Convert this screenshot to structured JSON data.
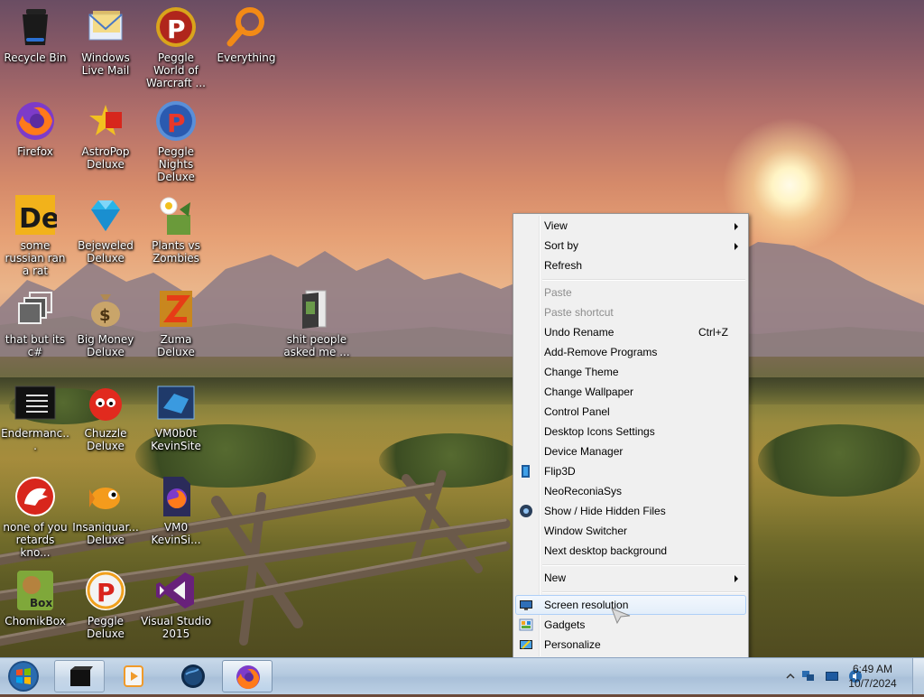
{
  "desktop": {
    "icons": [
      {
        "label": "Recycle Bin",
        "icon": "recycle-bin-icon"
      },
      {
        "label": "Windows Live Mail",
        "icon": "mail-icon"
      },
      {
        "label": "Peggle World of Warcraft ...",
        "icon": "peggle-icon"
      },
      {
        "label": "Everything",
        "icon": "magnifier-icon"
      },
      {
        "label": "Firefox",
        "icon": "firefox-icon"
      },
      {
        "label": "AstroPop Deluxe",
        "icon": "astropop-icon"
      },
      {
        "label": "Peggle Nights Deluxe",
        "icon": "peggle-icon"
      },
      {
        "label": "some russian ran a rat",
        "icon": "de-icon"
      },
      {
        "label": "Bejeweled Deluxe",
        "icon": "gem-icon"
      },
      {
        "label": "Plants vs Zombies",
        "icon": "plant-icon"
      },
      {
        "label": "that but its c#",
        "icon": "windows-stack-icon"
      },
      {
        "label": "Big Money Deluxe",
        "icon": "money-bag-icon"
      },
      {
        "label": "Zuma Deluxe",
        "icon": "zuma-icon"
      },
      {
        "label": "shit people asked me ...",
        "icon": "folder-icon"
      },
      {
        "label": "Endermanc...",
        "icon": "terminal-icon"
      },
      {
        "label": "Chuzzle Deluxe",
        "icon": "chuzzle-icon"
      },
      {
        "label": "VM0b0t KevinSite",
        "icon": "vm-icon"
      },
      {
        "label": "none of you retards kno...",
        "icon": "dino-icon"
      },
      {
        "label": "Insaniquar... Deluxe",
        "icon": "fish-icon"
      },
      {
        "label": "VM0 KevinSi...",
        "icon": "firefox-file-icon"
      },
      {
        "label": "ChomikBox",
        "icon": "chomikbox-icon"
      },
      {
        "label": "Peggle Deluxe",
        "icon": "peggle-icon"
      },
      {
        "label": "Visual Studio 2015",
        "icon": "visual-studio-icon"
      }
    ]
  },
  "context_menu": {
    "items": [
      {
        "label": "View",
        "submenu": true
      },
      {
        "label": "Sort by",
        "submenu": true
      },
      {
        "label": "Refresh"
      },
      {
        "label": "Paste",
        "disabled": true
      },
      {
        "label": "Paste shortcut",
        "disabled": true
      },
      {
        "label": "Undo Rename",
        "shortcut": "Ctrl+Z"
      },
      {
        "label": "Add-Remove Programs"
      },
      {
        "label": "Change Theme"
      },
      {
        "label": "Change Wallpaper"
      },
      {
        "label": "Control Panel"
      },
      {
        "label": "Desktop Icons Settings"
      },
      {
        "label": "Device Manager"
      },
      {
        "label": "Flip3D",
        "icon": "flip3d-icon"
      },
      {
        "label": "NeoReconiaSys"
      },
      {
        "label": "Show / Hide Hidden Files",
        "icon": "eye-icon"
      },
      {
        "label": "Window Switcher"
      },
      {
        "label": "Next desktop background"
      },
      {
        "label": "New",
        "submenu": true
      },
      {
        "label": "Screen resolution",
        "icon": "monitor-icon",
        "highlighted": true
      },
      {
        "label": "Gadgets",
        "icon": "gadgets-icon"
      },
      {
        "label": "Personalize",
        "icon": "personalize-icon"
      }
    ]
  },
  "taskbar": {
    "start_icon": "windows-orb-icon",
    "buttons": [
      {
        "icon": "black-box-icon",
        "state": "pinned"
      },
      {
        "icon": "media-player-icon",
        "state": "normal"
      },
      {
        "icon": "globe-icon",
        "state": "normal"
      },
      {
        "icon": "firefox-icon",
        "state": "active"
      }
    ],
    "tray_icons": [
      "show-hidden-icons-chevron",
      "network-icon",
      "display-icon",
      "volume-icon"
    ],
    "clock": {
      "time": "6:49 AM",
      "date": "10/7/2024"
    }
  },
  "colors": {
    "menu_bg": "#f0f0f0",
    "menu_highlight_border": "#aecff7",
    "taskbar": "#b4c9df",
    "disabled_text": "#8d8d8d"
  }
}
